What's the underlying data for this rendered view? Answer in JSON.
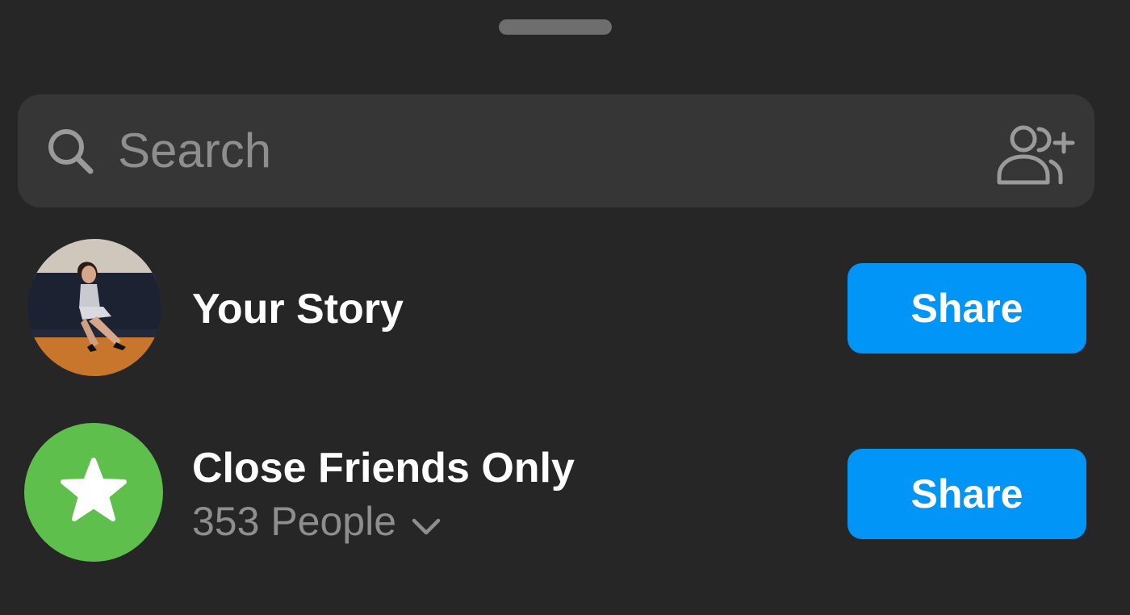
{
  "search": {
    "placeholder": "Search",
    "search_icon": "search-icon",
    "add_people_icon": "add-people-icon"
  },
  "rows": [
    {
      "title": "Your Story",
      "share_label": "Share",
      "avatar": "profile-photo"
    },
    {
      "title": "Close Friends Only",
      "subtitle": "353 People",
      "subtitle_icon": "chevron-down-icon",
      "icon": "star-icon",
      "share_label": "Share"
    }
  ],
  "colors": {
    "background": "#262626",
    "search_background": "#363636",
    "share_button": "#0095f6",
    "close_friends_green": "#5fbf4d",
    "secondary_text": "#8e8e8e",
    "primary_text": "#ffffff"
  }
}
